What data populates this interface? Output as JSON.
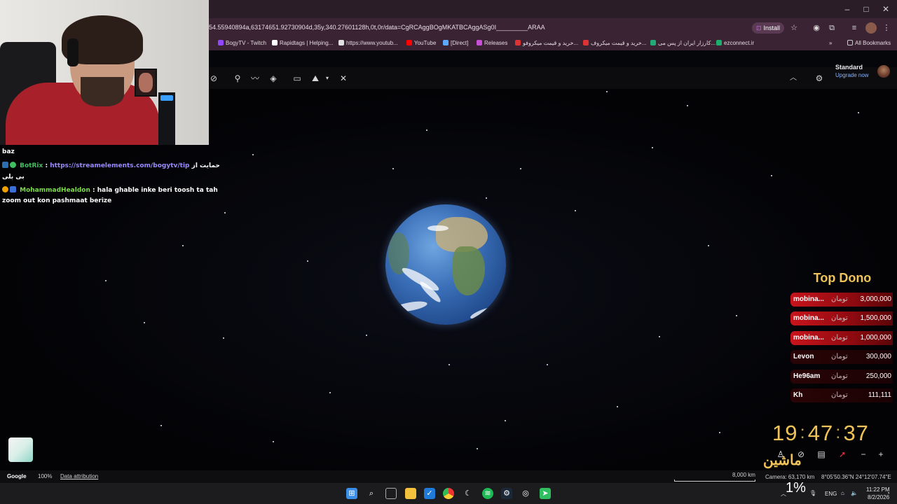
{
  "browser": {
    "url": "54.55940894a,63174651.92730904d,35y,340.27601128h,0t,0r/data=CgRCAggBOgMKATBCAggASg0I_________ARAA",
    "install_label": "Install",
    "bookmarks": [
      {
        "label": "BogyTV - Twitch",
        "color": "#9146ff"
      },
      {
        "label": "Rapidtags | Helping...",
        "color": "#ffffff"
      },
      {
        "label": "https://www.youtub...",
        "color": "#e0e0e0"
      },
      {
        "label": "YouTube",
        "color": "#ff0000"
      },
      {
        "label": "[Direct]",
        "color": "#5aa9ff"
      },
      {
        "label": "Releases",
        "color": "#c84fd6"
      },
      {
        "label": "خرید و قیمت میکروفو...",
        "color": "#d33"
      },
      {
        "label": "خرید و قیمت میکروف...",
        "color": "#d33"
      },
      {
        "label": "کارزار ایران از پس می...",
        "color": "#2a7"
      },
      {
        "label": "ezconnect.ir",
        "color": "#1cae6d"
      }
    ],
    "all_bookmarks_label": "All Bookmarks"
  },
  "earth": {
    "plan_name": "Standard",
    "plan_upgrade": "Upgrade now",
    "tools": [
      "history-icon",
      "placemark-icon",
      "path-icon",
      "layers-icon",
      "ruler-icon",
      "projects-icon",
      "measure-icon"
    ]
  },
  "chat": {
    "line0": "baz",
    "bot_name": "BotRix",
    "bot_link": "https://streamelements.com/bogytv/tip",
    "bot_tail": "حمایت از",
    "bot_tail2": "بی بلی",
    "user_name": "MohammadHealdon",
    "user_msg1": "hala ghable inke beri toosh ta tah",
    "user_msg2": "zoom out kon pashmaat berize"
  },
  "dono": {
    "title": "Top Dono",
    "currency": "تومان",
    "rows": [
      {
        "name": "mobina...",
        "amount": "3,000,000"
      },
      {
        "name": "mobina...",
        "amount": "1,500,000"
      },
      {
        "name": "mobina...",
        "amount": "1,000,000"
      },
      {
        "name": "Levon",
        "amount": "300,000"
      },
      {
        "name": "He96am",
        "amount": "250,000"
      },
      {
        "name": "Kh",
        "amount": "111,111"
      }
    ]
  },
  "clock": {
    "h": "19",
    "m": "47",
    "s": "37",
    "sep": ":"
  },
  "fa_text": "ماشین",
  "statusbar": {
    "google": "Google",
    "zoom": "100%",
    "attribution": "Data attribution",
    "scale": "8,000 km",
    "camera": "Camera: 63,170 km",
    "coords": "8°05'50.36\"N 24°12'07.74\"E"
  },
  "tray": {
    "percent": "1%",
    "lang": "ENG",
    "time": "11:22 PM",
    "date": "8/2/2026"
  }
}
